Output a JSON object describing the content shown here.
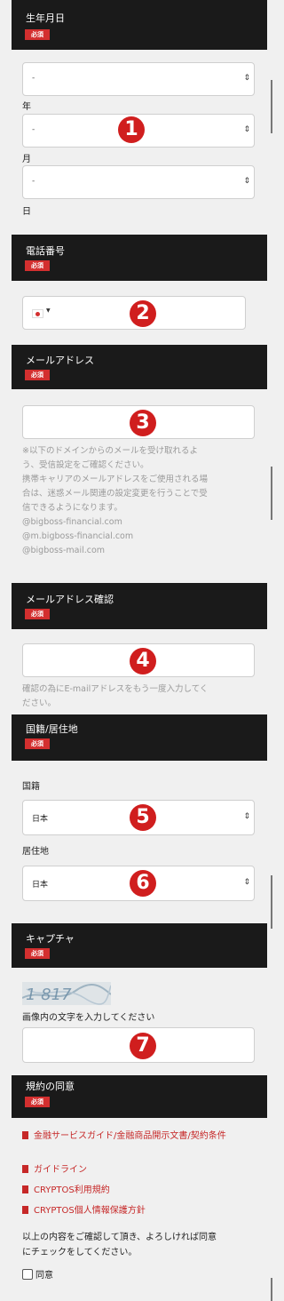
{
  "required_badge": "必須",
  "birthdate": {
    "title": "生年月日",
    "year": {
      "value": "-",
      "label": "年"
    },
    "month": {
      "value": "-",
      "label": "月"
    },
    "day": {
      "value": "-",
      "label": "日"
    }
  },
  "phone": {
    "title": "電話番号",
    "country_flag": "Japan",
    "input_value": ""
  },
  "email": {
    "title": "メールアドレス",
    "input_value": "",
    "note_lines": [
      "※以下のドメインからのメールを受け取れるよ",
      "う、受信設定をご確認ください。",
      "携帯キャリアのメールアドレスをご使用される場",
      "合は、迷惑メール関連の設定変更を行うことで受",
      "信できるようになります。",
      "@bigboss-financial.com",
      "@m.bigboss-financial.com",
      "@bigboss-mail.com"
    ]
  },
  "email_confirm": {
    "title": "メールアドレス確認",
    "input_value": "",
    "note_lines": [
      "確認の為にE-mailアドレスをもう一度入力してく",
      "ださい。"
    ]
  },
  "nationality": {
    "title": "国籍/居住地",
    "nationality_label": "国籍",
    "nationality_value": "日本",
    "residence_label": "居住地",
    "residence_value": "日本"
  },
  "captcha": {
    "title": "キャプチャ",
    "image_text": "1 817",
    "instruction": "画像内の文字を入力してください",
    "input_value": ""
  },
  "terms": {
    "title": "規約の同意",
    "documents": [
      "金融サービスガイド/金融商品開示文書/契約条件",
      "ガイドライン",
      "CRYPTOS利用規約",
      "CRYPTOS個人情報保護方針"
    ],
    "notice_lines": [
      "以上の内容をご確認して頂き、よろしければ同意",
      "にチェックをしてください。"
    ],
    "agree_label": "同意"
  },
  "annotations": [
    "1",
    "2",
    "3",
    "4",
    "5",
    "6",
    "7"
  ],
  "colors": {
    "accent_red": "#d01e1e",
    "header_bg": "#1a1a1a"
  }
}
